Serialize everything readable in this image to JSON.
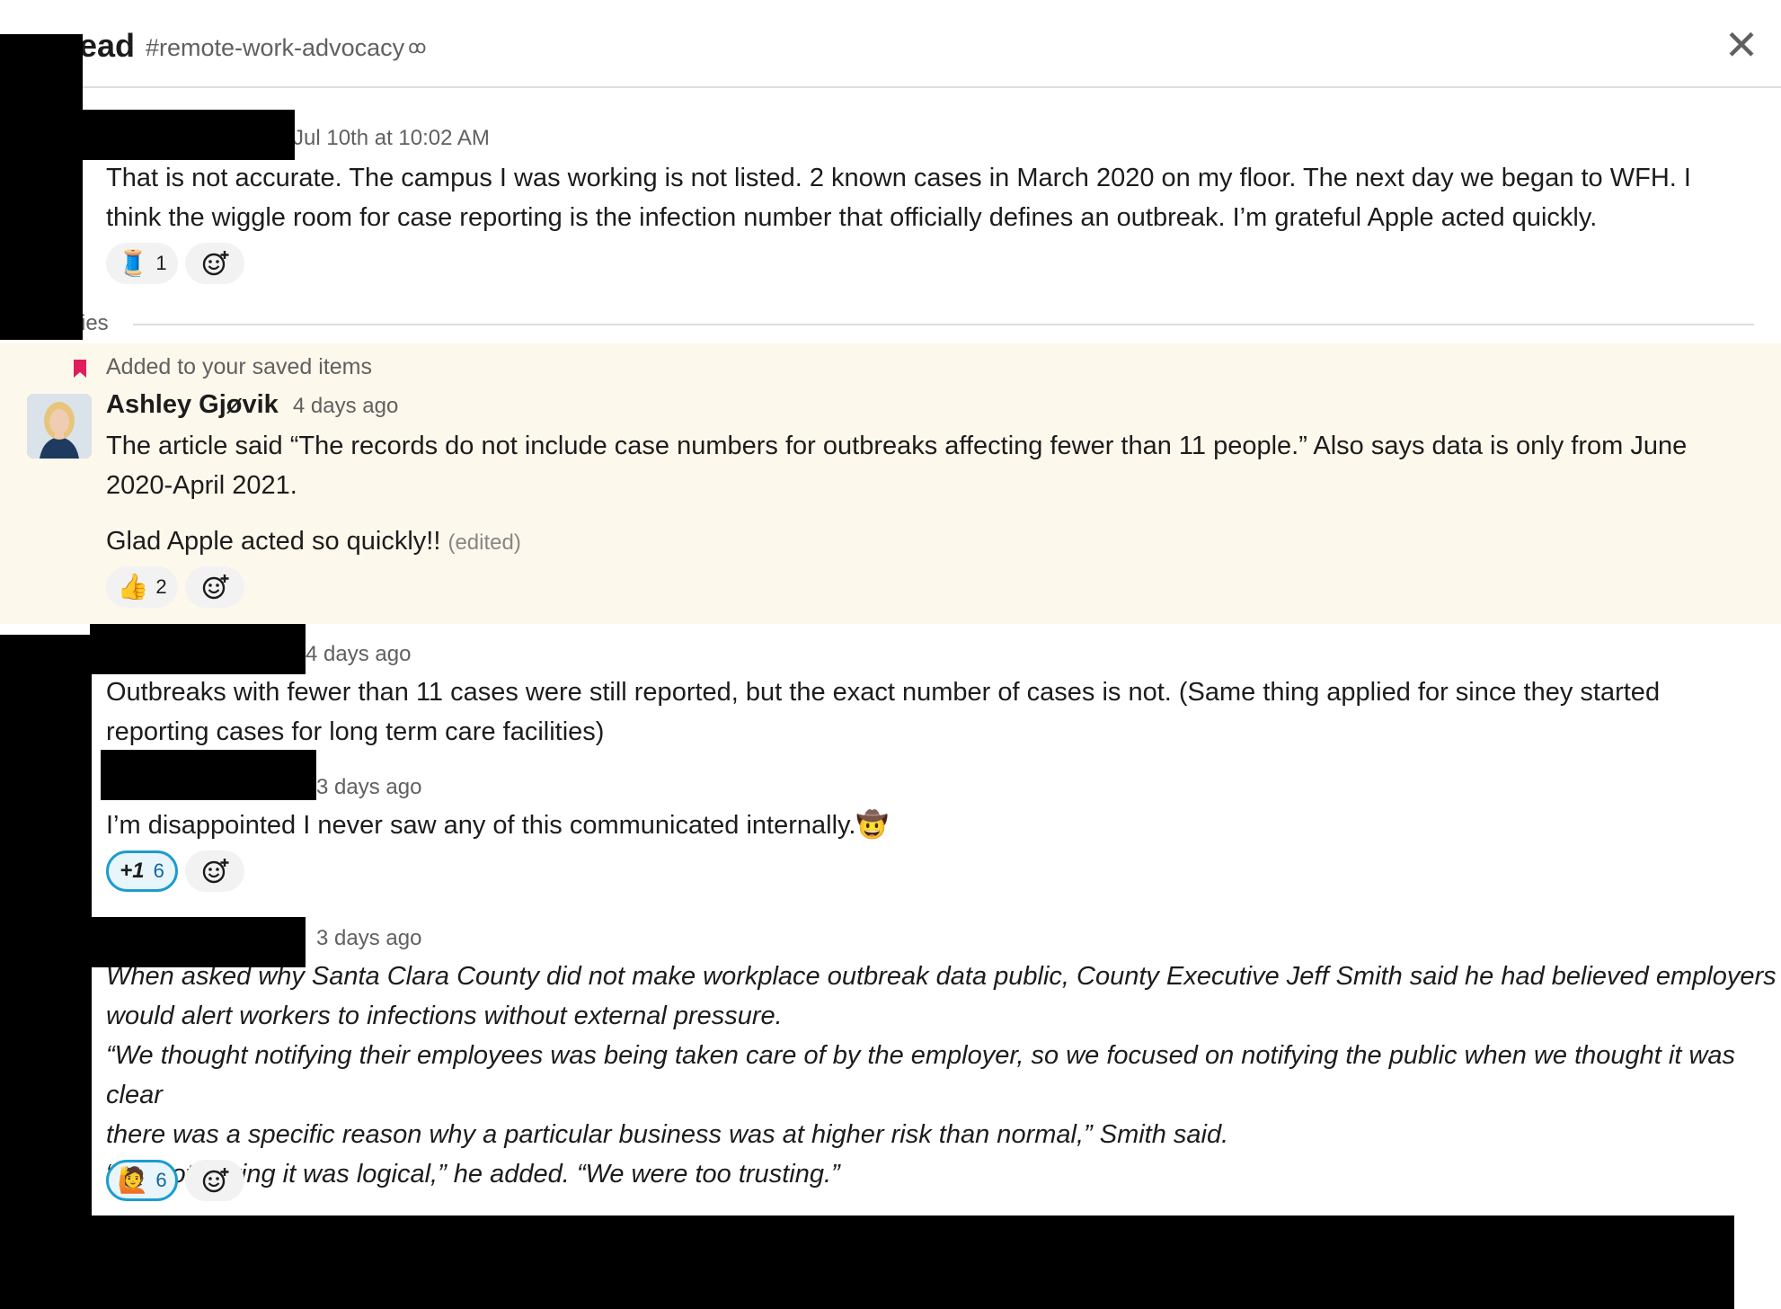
{
  "header": {
    "title_fragment": "ead",
    "channel": "#remote-work-advocacy",
    "close_icon": "close-icon"
  },
  "replies_label_fragment": "ies",
  "saved_label": "Added to your saved items",
  "messages": [
    {
      "timestamp": "Jul 10th at 10:02 AM",
      "lines": [
        "That is not accurate. The campus I was working is not listed. 2 known cases in March 2020 on my floor. The next day we began to WFH. I",
        "think the wiggle room for case reporting is the infection number that officially defines an outbreak. I’m grateful Apple acted quickly."
      ],
      "reaction": {
        "emoji": "🧵",
        "count": "1"
      }
    },
    {
      "author": "Ashley Gjøvik",
      "timestamp": "4 days ago",
      "lines": [
        "The article said “The records do not include case numbers for outbreaks affecting fewer than 11 people.” Also says data is only from June",
        "2020-April 2021."
      ],
      "second_paragraph": "Glad Apple acted so quickly!!",
      "edited": "(edited)",
      "reaction": {
        "emoji": "👍",
        "count": "2"
      }
    },
    {
      "timestamp": "4 days ago",
      "lines": [
        "Outbreaks with fewer than 11 cases were still reported, but the exact number of cases is not. (Same thing applied for since they started",
        "reporting cases for long term care facilities)"
      ]
    },
    {
      "timestamp": "3 days ago",
      "text": "I’m disappointed I never saw any of this communicated internally.",
      "inline_emoji": "🤠",
      "reaction": {
        "label": "+1",
        "count": "6"
      }
    },
    {
      "timestamp": "3 days ago",
      "lines": [
        "When asked why Santa Clara County did not make workplace outbreak data public, County Executive Jeff Smith said he had believed employers",
        "would alert workers to infections without external pressure.",
        "“We thought notifying their employees was being taken care of by the employer, so we focused on notifying the public when we thought it was clear",
        "there was a specific reason why a particular business was at higher risk than normal,” Smith said.",
        "“I’m not saying it was logical,” he added. “We were too trusting.”"
      ],
      "reaction": {
        "emoji": "🙋",
        "count": "6"
      }
    }
  ]
}
